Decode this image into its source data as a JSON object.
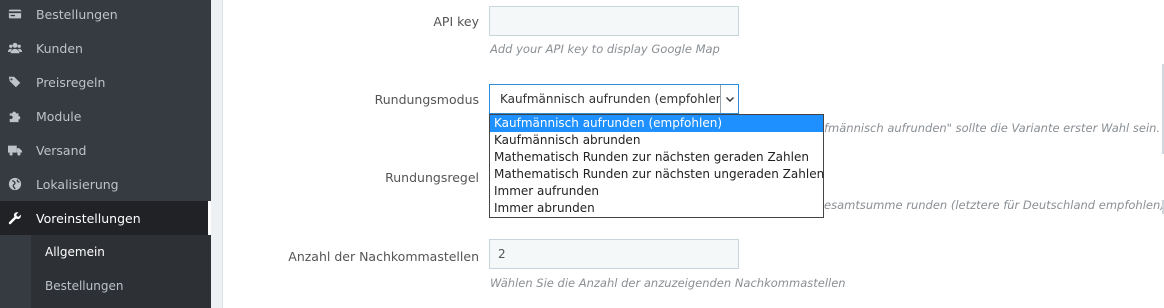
{
  "sidebar": {
    "items": [
      {
        "label": "Bestellungen",
        "icon": "credit-card-icon"
      },
      {
        "label": "Kunden",
        "icon": "users-icon"
      },
      {
        "label": "Preisregeln",
        "icon": "tags-icon"
      },
      {
        "label": "Module",
        "icon": "puzzle-icon"
      },
      {
        "label": "Versand",
        "icon": "truck-icon"
      },
      {
        "label": "Lokalisierung",
        "icon": "globe-icon"
      },
      {
        "label": "Voreinstellungen",
        "icon": "wrench-icon"
      }
    ],
    "subitems": [
      {
        "label": "Allgemein"
      },
      {
        "label": "Bestellungen"
      }
    ]
  },
  "form": {
    "api_key": {
      "label": "API key",
      "value": "",
      "help": "Add your API key to display Google Map"
    },
    "rounding_mode": {
      "label": "Rundungsmodus",
      "selected": "Kaufmännisch aufrunden (empfohlen)",
      "help_partial": "fmännisch aufrunden\" sollte die Variante erster Wahl sein.",
      "options": [
        "Kaufmännisch aufrunden (empfohlen)",
        "Kaufmännisch abrunden",
        "Mathematisch Runden zur nächsten geraden Zahlen",
        "Mathematisch Runden zur nächsten ungeraden Zahlen",
        "Immer aufrunden",
        "Immer abrunden"
      ]
    },
    "rounding_rule": {
      "label": "Rundungsregel",
      "help_partial": "esamtsumme runden (letztere für Deutschland empfohlen)"
    },
    "decimals": {
      "label": "Anzahl der Nachkommastellen",
      "value": "2",
      "help": "Wählen Sie die Anzahl der anzuzeigenden Nachkommastellen"
    }
  },
  "colors": {
    "sidebar_bg": "#363a41",
    "accent": "#1e90ff"
  }
}
